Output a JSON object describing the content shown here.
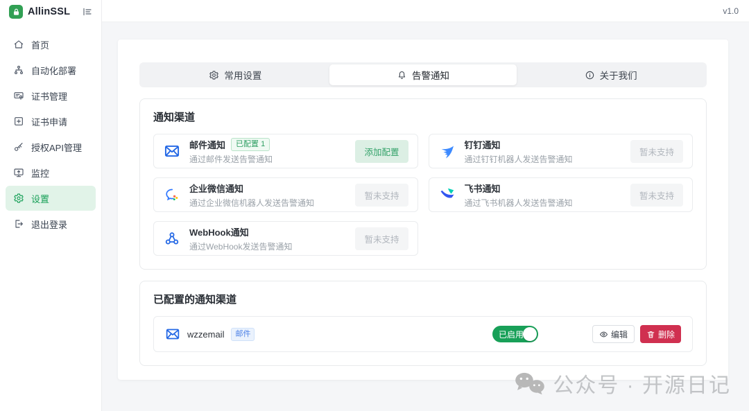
{
  "app": {
    "name": "AllinSSL",
    "version": "v1.0",
    "logo_icon": "lock-icon",
    "collapse_icon": "menu-fold-icon"
  },
  "sidebar": {
    "items": [
      {
        "name": "home",
        "icon": "home-icon",
        "label": "首页",
        "active": false
      },
      {
        "name": "auto-deploy",
        "icon": "deploy-icon",
        "label": "自动化部署",
        "active": false
      },
      {
        "name": "cert-manage",
        "icon": "certificate-icon",
        "label": "证书管理",
        "active": false
      },
      {
        "name": "cert-apply",
        "icon": "add-square-icon",
        "label": "证书申请",
        "active": false
      },
      {
        "name": "api-auth",
        "icon": "key-icon",
        "label": "授权API管理",
        "active": false
      },
      {
        "name": "monitor",
        "icon": "monitor-icon",
        "label": "监控",
        "active": false
      },
      {
        "name": "settings",
        "icon": "gear-icon",
        "label": "设置",
        "active": true
      },
      {
        "name": "logout",
        "icon": "logout-icon",
        "label": "退出登录",
        "active": false
      }
    ]
  },
  "tabs": [
    {
      "name": "general-settings",
      "icon": "gear-icon",
      "label": "常用设置",
      "active": false
    },
    {
      "name": "alert-notification",
      "icon": "bell-icon",
      "label": "告警通知",
      "active": true
    },
    {
      "name": "about-us",
      "icon": "info-icon",
      "label": "关于我们",
      "active": false
    }
  ],
  "channels": {
    "title": "通知渠道",
    "cards": [
      {
        "name": "email",
        "icon": "email-icon",
        "title": "邮件通知",
        "badge": "已配置 1",
        "desc": "通过邮件发送告警通知",
        "action": "添加配置",
        "action_type": "primary"
      },
      {
        "name": "dingtalk",
        "icon": "dingtalk-icon",
        "title": "钉钉通知",
        "badge": null,
        "desc": "通过钉钉机器人发送告警通知",
        "action": "暂未支持",
        "action_type": "disabled"
      },
      {
        "name": "wecom",
        "icon": "wecom-icon",
        "title": "企业微信通知",
        "badge": null,
        "desc": "通过企业微信机器人发送告警通知",
        "action": "暂未支持",
        "action_type": "disabled"
      },
      {
        "name": "feishu",
        "icon": "feishu-icon",
        "title": "飞书通知",
        "badge": null,
        "desc": "通过飞书机器人发送告警通知",
        "action": "暂未支持",
        "action_type": "disabled"
      },
      {
        "name": "webhook",
        "icon": "webhook-icon",
        "title": "WebHook通知",
        "badge": null,
        "desc": "通过WebHook发送告警通知",
        "action": "暂未支持",
        "action_type": "disabled"
      }
    ]
  },
  "configured": {
    "title": "已配置的通知渠道",
    "rows": [
      {
        "name": "wzzemail",
        "icon": "email-icon",
        "type_badge": "邮件",
        "toggle_label": "已启用",
        "enabled": true,
        "edit_label": "编辑",
        "delete_label": "删除"
      }
    ]
  },
  "watermark": {
    "icon": "wechat-icon",
    "text": "公众号 · 开源日记"
  },
  "colors": {
    "accent_green": "#18a058",
    "sidebar_active_bg": "#e1f3e8",
    "danger_red": "#d03050",
    "brand_blue": "#2468e5",
    "badge_green_text": "#2f9e63",
    "badge_blue_text": "#4e82e6",
    "disabled_text": "#b1b6bd",
    "page_bg": "#f5f6f8"
  }
}
